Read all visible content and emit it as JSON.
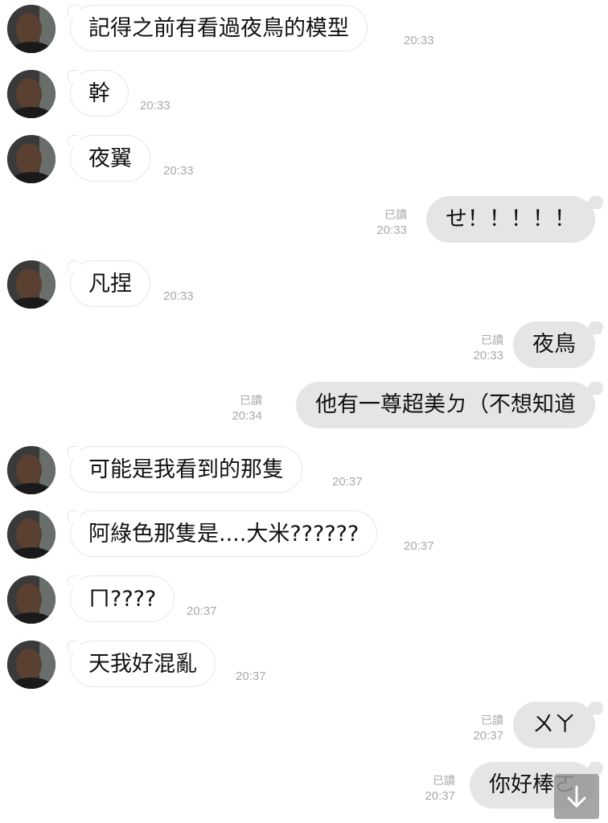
{
  "messages": [
    {
      "dir": "in",
      "text": "記得之前有看過夜鳥的模型",
      "time": "20:33"
    },
    {
      "dir": "in",
      "text": "幹",
      "time": "20:33"
    },
    {
      "dir": "in",
      "text": "夜翼",
      "time": "20:33"
    },
    {
      "dir": "out",
      "text": "せ！！！！！",
      "time": "20:33",
      "read": "已讀"
    },
    {
      "dir": "in",
      "text": "凡捏",
      "time": "20:33"
    },
    {
      "dir": "out",
      "text": "夜鳥",
      "time": "20:33",
      "read": "已讀"
    },
    {
      "dir": "out",
      "text": "他有一尊超美ㄉ（不想知道",
      "time": "20:34",
      "read": "已讀"
    },
    {
      "dir": "in",
      "text": "可能是我看到的那隻",
      "time": "20:37"
    },
    {
      "dir": "in",
      "text": "阿綠色那隻是....大米??????",
      "time": "20:37"
    },
    {
      "dir": "in",
      "text": "ㄇ????",
      "time": "20:37"
    },
    {
      "dir": "in",
      "text": "天我好混亂",
      "time": "20:37"
    },
    {
      "dir": "out",
      "text": "ㄨㄚ",
      "time": "20:37",
      "read": "已讀"
    },
    {
      "dir": "out",
      "text": "你好棒ㄛ",
      "time": "20:37",
      "read": "已讀"
    }
  ],
  "icons": {
    "avatar": "contact-avatar-photo",
    "scroll": "arrow-down-icon"
  },
  "colors": {
    "incoming_bubble": "#ffffff",
    "outgoing_bubble": "#e5e5e5",
    "meta_text": "#a8a8a8"
  }
}
